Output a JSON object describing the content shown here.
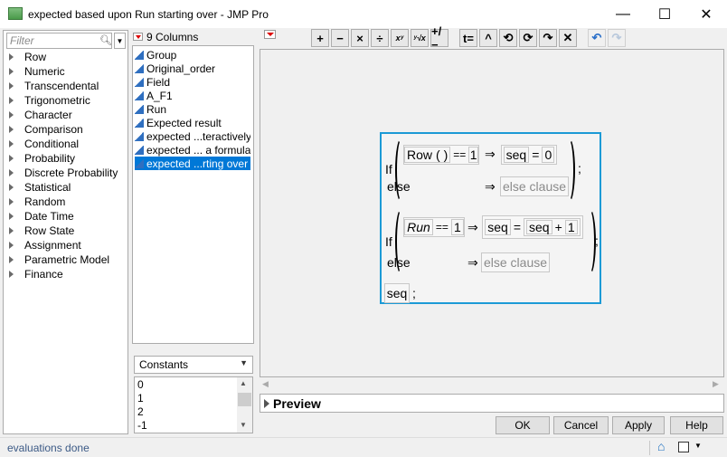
{
  "window": {
    "title": "expected based upon Run starting over - JMP Pro",
    "minimize_glyph": "—",
    "maximize_glyph": "☐",
    "close_glyph": "✕",
    "app_icon": "jmp-table-icon"
  },
  "function_panel": {
    "filter_placeholder": "Filter",
    "categories": [
      "Row",
      "Numeric",
      "Transcendental",
      "Trigonometric",
      "Character",
      "Comparison",
      "Conditional",
      "Probability",
      "Discrete Probability",
      "Statistical",
      "Random",
      "Date Time",
      "Row State",
      "Assignment",
      "Parametric Model",
      "Finance"
    ]
  },
  "columns_panel": {
    "count_label": "9 Columns",
    "columns": [
      "Group",
      "Original_order",
      "Field",
      "A_F1",
      "Run",
      "Expected result",
      "expected ...teractively",
      "expected ... a formula",
      "expected ...rting over"
    ],
    "selected_index": 8
  },
  "constants": {
    "selector_label": "Constants",
    "values": [
      "0",
      "1",
      "2",
      "-1"
    ]
  },
  "toolbar": {
    "buttons": [
      "+",
      "−",
      "×",
      "÷",
      "xʸ",
      "ʸ√x",
      "+/−",
      "t=",
      "^",
      "⟲",
      "⟳",
      "↷",
      "✕",
      "↶",
      "↷"
    ]
  },
  "formula": {
    "if1": {
      "keyword": "If",
      "cond_fn": "Row",
      "cond_parens": "( )",
      "cond_op": "==",
      "cond_val": "1",
      "arrow": "⇒",
      "assign_var": "seq",
      "assign_op": "=",
      "assign_val": "0",
      "else_label": "else",
      "else_clause": "else clause",
      "terminator": ";"
    },
    "if2": {
      "keyword": "If",
      "cond_var": "Run",
      "cond_op": "==",
      "cond_val": "1",
      "arrow": "⇒",
      "assign_var": "seq",
      "assign_op": "=",
      "rhs_var": "seq",
      "rhs_op": "+",
      "rhs_val": "1",
      "else_label": "else",
      "else_clause": "else clause",
      "terminator": ";"
    },
    "final_var": "seq",
    "final_term": ";"
  },
  "preview": {
    "label": "Preview"
  },
  "dialog_buttons": {
    "ok": "OK",
    "cancel": "Cancel",
    "apply": "Apply",
    "help": "Help"
  },
  "status": {
    "text": "evaluations done"
  }
}
